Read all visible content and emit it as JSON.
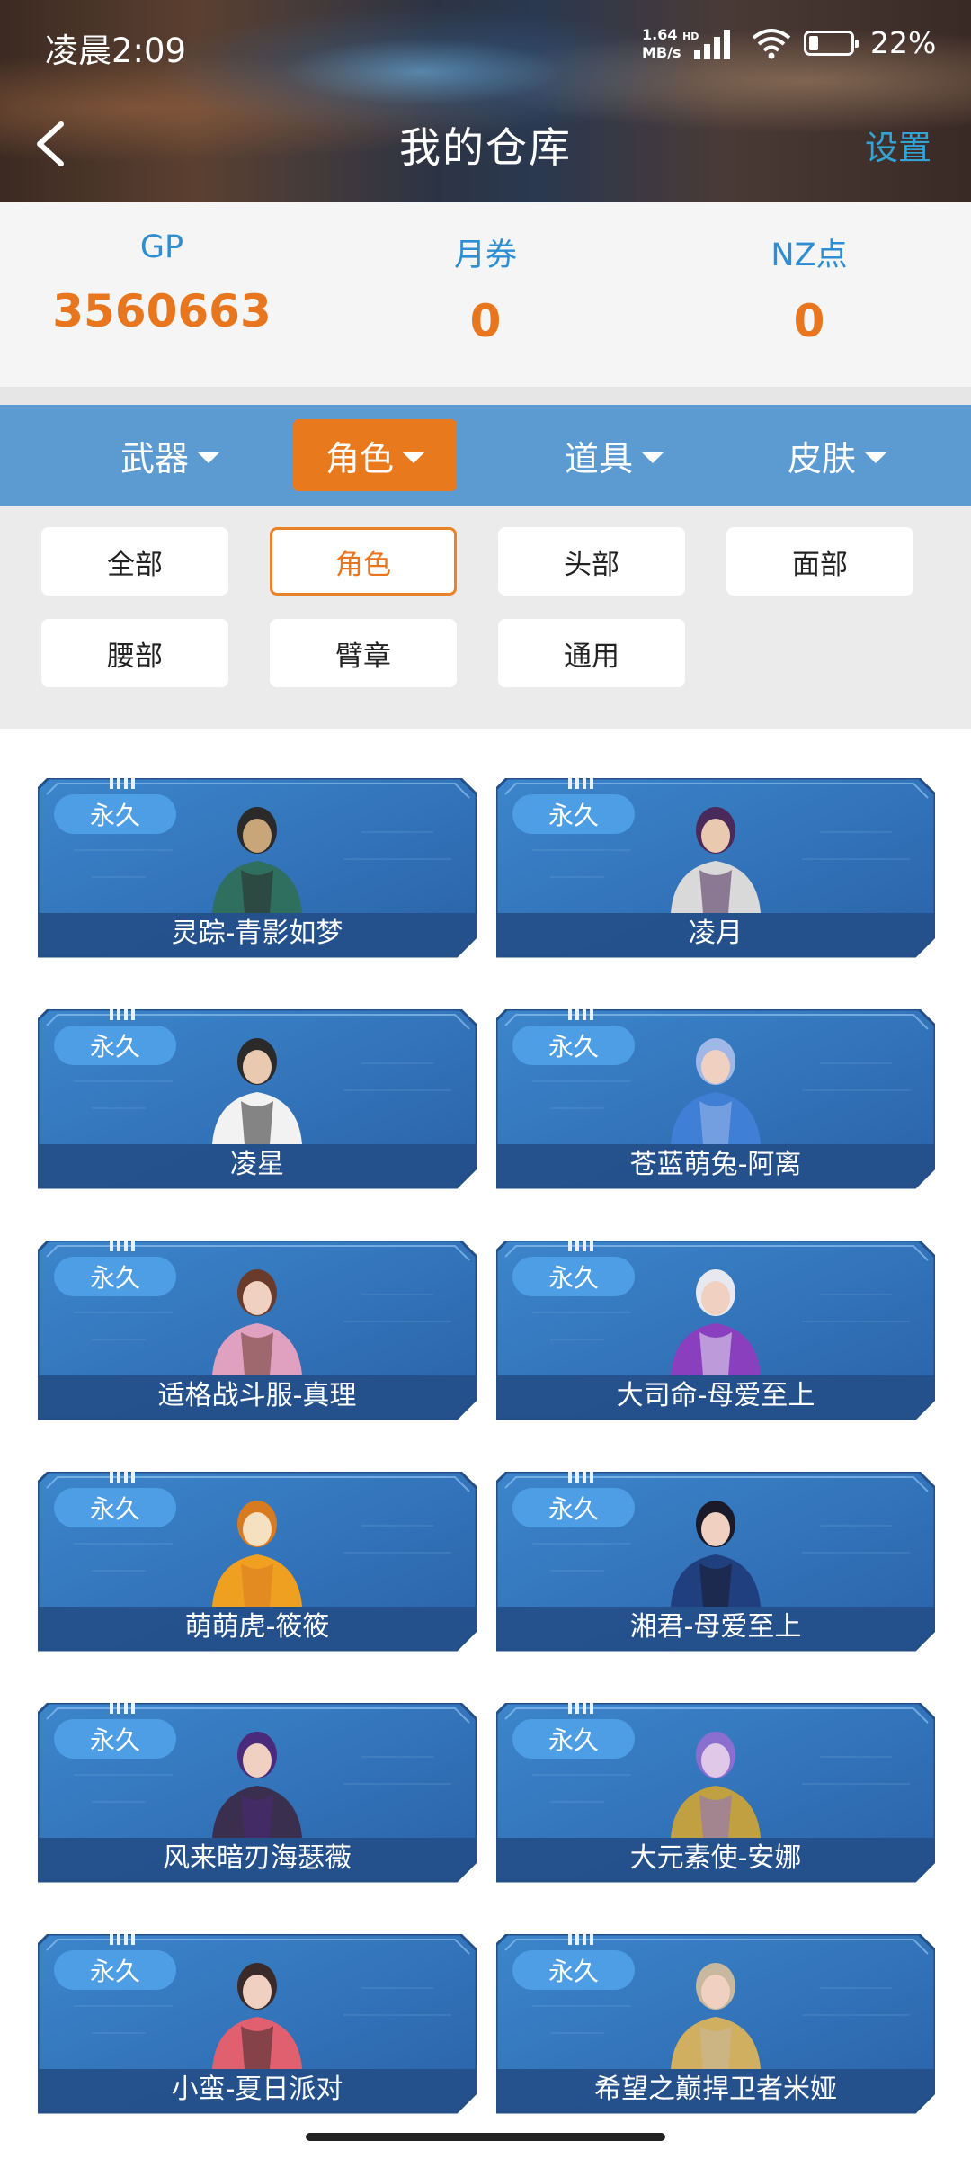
{
  "status_bar": {
    "time": "凌晨2:09",
    "speed_value": "1.64",
    "speed_unit": "MB/s",
    "network": "HD",
    "battery": "22%",
    "battery_level": 0.22
  },
  "header": {
    "title": "我的仓库",
    "settings_label": "设置",
    "back_icon": "chevron-left-icon"
  },
  "balances": [
    {
      "label": "GP",
      "value": "3560663"
    },
    {
      "label": "月券",
      "value": "0"
    },
    {
      "label": "NZ点",
      "value": "0"
    }
  ],
  "tabs": [
    {
      "label": "武器",
      "active": false
    },
    {
      "label": "角色",
      "active": true
    },
    {
      "label": "道具",
      "active": false
    },
    {
      "label": "皮肤",
      "active": false
    }
  ],
  "filters": [
    {
      "label": "全部",
      "active": false
    },
    {
      "label": "角色",
      "active": true
    },
    {
      "label": "头部",
      "active": false
    },
    {
      "label": "面部",
      "active": false
    },
    {
      "label": "腰部",
      "active": false
    },
    {
      "label": "臂章",
      "active": false
    },
    {
      "label": "通用",
      "active": false
    }
  ],
  "items": [
    {
      "badge": "永久",
      "name": "灵踪-青影如梦",
      "colors": [
        "#2f6f5f",
        "#c9a57a",
        "#2a2a2a"
      ]
    },
    {
      "badge": "永久",
      "name": "凌月",
      "colors": [
        "#d9d9d9",
        "#e9c9b0",
        "#4a2a5a"
      ]
    },
    {
      "badge": "永久",
      "name": "凌星",
      "colors": [
        "#f2f2f2",
        "#e9c9b0",
        "#2a2a2a"
      ]
    },
    {
      "badge": "永久",
      "name": "苍蓝萌兔-阿离",
      "colors": [
        "#3f7fd6",
        "#f0d0c0",
        "#9fb8e8"
      ]
    },
    {
      "badge": "永久",
      "name": "适格战斗服-真理",
      "colors": [
        "#e0a0c0",
        "#f0d0c0",
        "#6a3a2a"
      ]
    },
    {
      "badge": "永久",
      "name": "大司命-母爱至上",
      "colors": [
        "#8a3fbf",
        "#f0d0c0",
        "#e8e8f0"
      ]
    },
    {
      "badge": "永久",
      "name": "萌萌虎-筱筱",
      "colors": [
        "#f0a020",
        "#f5e0c0",
        "#d87a20"
      ]
    },
    {
      "badge": "永久",
      "name": "湘君-母爱至上",
      "colors": [
        "#1f3f7f",
        "#f0d0c0",
        "#1a1a2a"
      ]
    },
    {
      "badge": "永久",
      "name": "风来暗刃海瑟薇",
      "colors": [
        "#3a2f4f",
        "#f0d0c0",
        "#4a2a7a"
      ]
    },
    {
      "badge": "永久",
      "name": "大元素使-安娜",
      "colors": [
        "#c0a040",
        "#e0c8e8",
        "#8a6fd0"
      ]
    },
    {
      "badge": "永久",
      "name": "小蛮-夏日派对",
      "colors": [
        "#e06070",
        "#f0d0c0",
        "#3a2a2a"
      ]
    },
    {
      "badge": "永久",
      "name": "希望之巅捍卫者米娅",
      "colors": [
        "#d0b060",
        "#f0d0c0",
        "#c8b8a0"
      ]
    }
  ]
}
